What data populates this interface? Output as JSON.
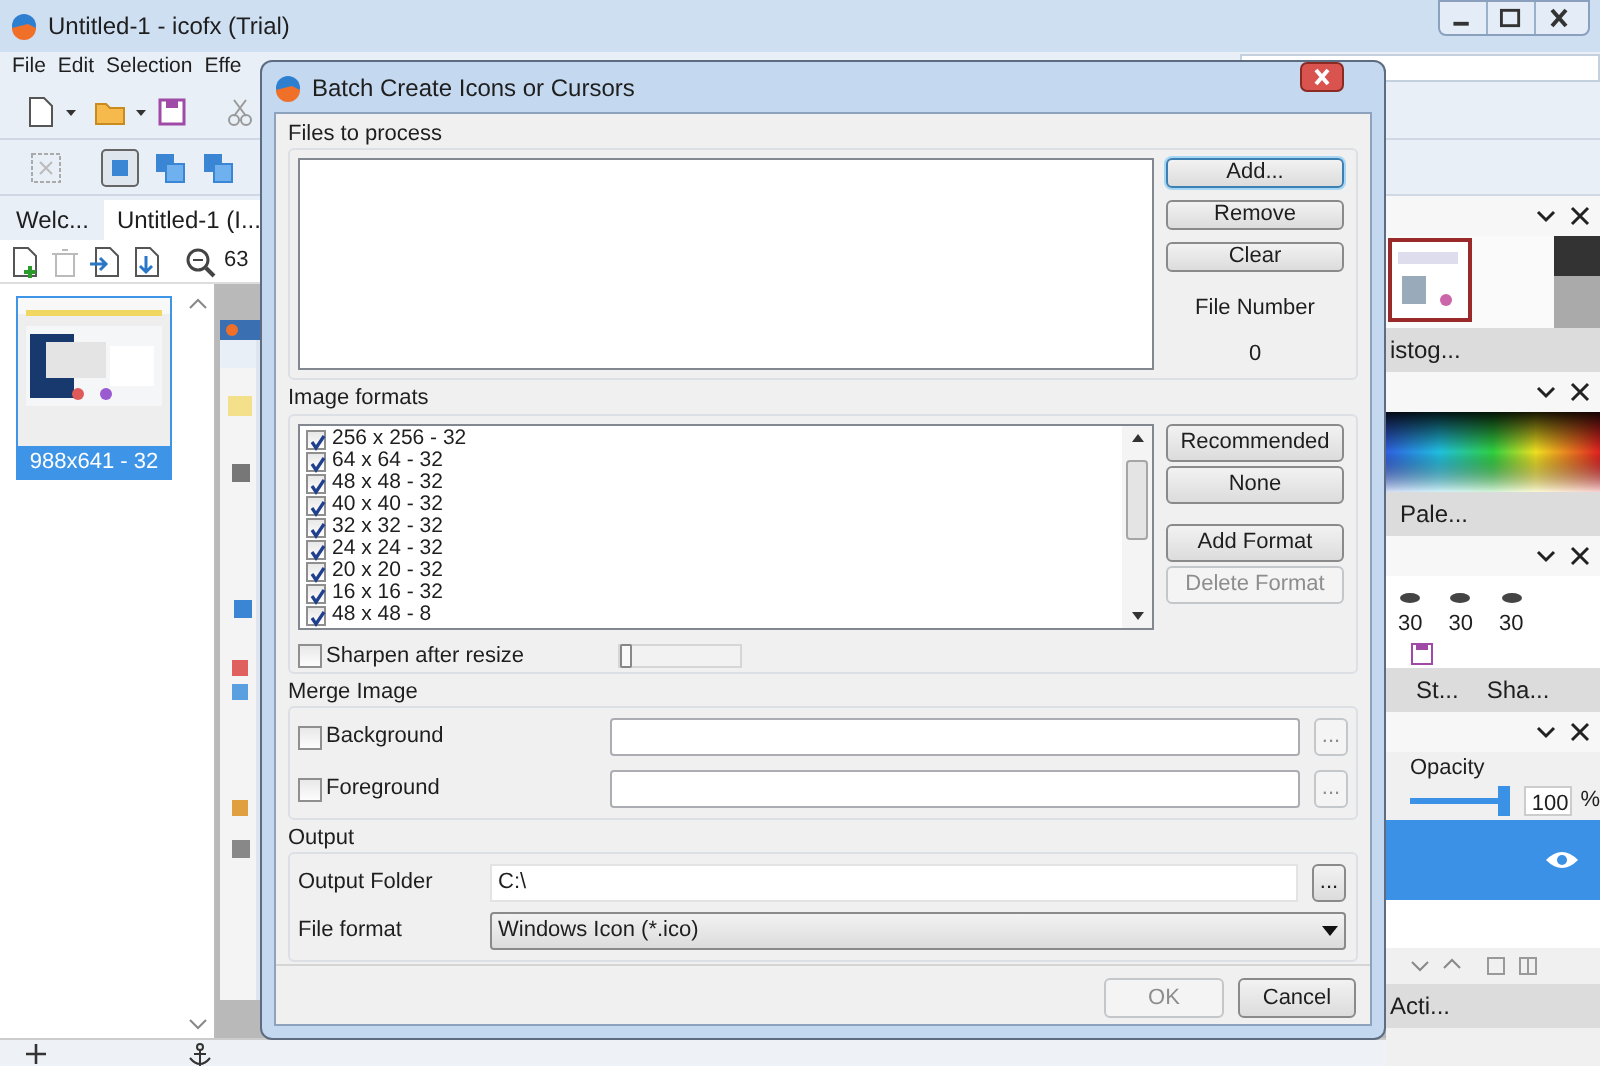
{
  "app": {
    "title": "Untitled-1 - icofx (Trial)",
    "menu": [
      "File",
      "Edit",
      "Selection",
      "Effe"
    ],
    "tabs": [
      {
        "label": "Welc...",
        "selected": false
      },
      {
        "label": "Untitled-1 (I...",
        "selected": true
      }
    ],
    "zoom": "63",
    "thumbnail": {
      "caption": "988x641 - 32",
      "selected": true
    }
  },
  "right_panels": {
    "histogram_tab": "istog...",
    "palette_tab": "Pale...",
    "brush_sizes": [
      "30",
      "30",
      "30"
    ],
    "tabs": [
      "St...",
      "Sha..."
    ],
    "opacity_label": "Opacity",
    "opacity": {
      "level": 0.95
    },
    "opacity_value": "100",
    "opacity_unit": "%",
    "layer": {
      "selected": true
    },
    "actions_tab": "Acti..."
  },
  "dialog": {
    "title": "Batch Create Icons or Cursors",
    "files": {
      "title": "Files to process",
      "buttons": [
        {
          "label": "Add...",
          "disabled": false,
          "focused": true
        },
        {
          "label": "Remove",
          "disabled": false,
          "focused": false
        },
        {
          "label": "Clear",
          "disabled": false,
          "focused": false
        }
      ],
      "file_number_label": "File Number",
      "file_number": "0"
    },
    "formats": {
      "title": "Image formats",
      "items": [
        {
          "label": "256 x 256 - 32",
          "checked": true
        },
        {
          "label": "64 x 64 - 32",
          "checked": true
        },
        {
          "label": "48 x 48 - 32",
          "checked": true
        },
        {
          "label": "40 x 40 - 32",
          "checked": true
        },
        {
          "label": "32 x 32 - 32",
          "checked": true
        },
        {
          "label": "24 x 24 - 32",
          "checked": true
        },
        {
          "label": "20 x 20 - 32",
          "checked": true
        },
        {
          "label": "16 x 16 - 32",
          "checked": true
        },
        {
          "label": "48 x 48 - 8",
          "checked": true
        }
      ],
      "buttons": [
        {
          "label": "Recommended",
          "disabled": false
        },
        {
          "label": "None",
          "disabled": false
        },
        {
          "label": "Add Format",
          "disabled": false
        },
        {
          "label": "Delete Format",
          "disabled": true
        }
      ],
      "sharpen": {
        "label": "Sharpen after resize",
        "checked": false
      },
      "sharpen_slider": {
        "level": 0
      }
    },
    "merge": {
      "title": "Merge Image",
      "rows": [
        {
          "label": "Background",
          "checked": false,
          "browse": {
            "label": "...",
            "disabled": true
          }
        },
        {
          "label": "Foreground",
          "checked": false,
          "browse": {
            "label": "...",
            "disabled": true
          }
        }
      ]
    },
    "output": {
      "title": "Output",
      "folder_label": "Output Folder",
      "folder_value": "C:\\",
      "browse": {
        "label": "...",
        "disabled": false
      },
      "format_label": "File format",
      "format_value": "Windows Icon (*.ico)"
    },
    "footer": [
      {
        "label": "OK",
        "disabled": true
      },
      {
        "label": "Cancel",
        "disabled": false
      }
    ]
  }
}
